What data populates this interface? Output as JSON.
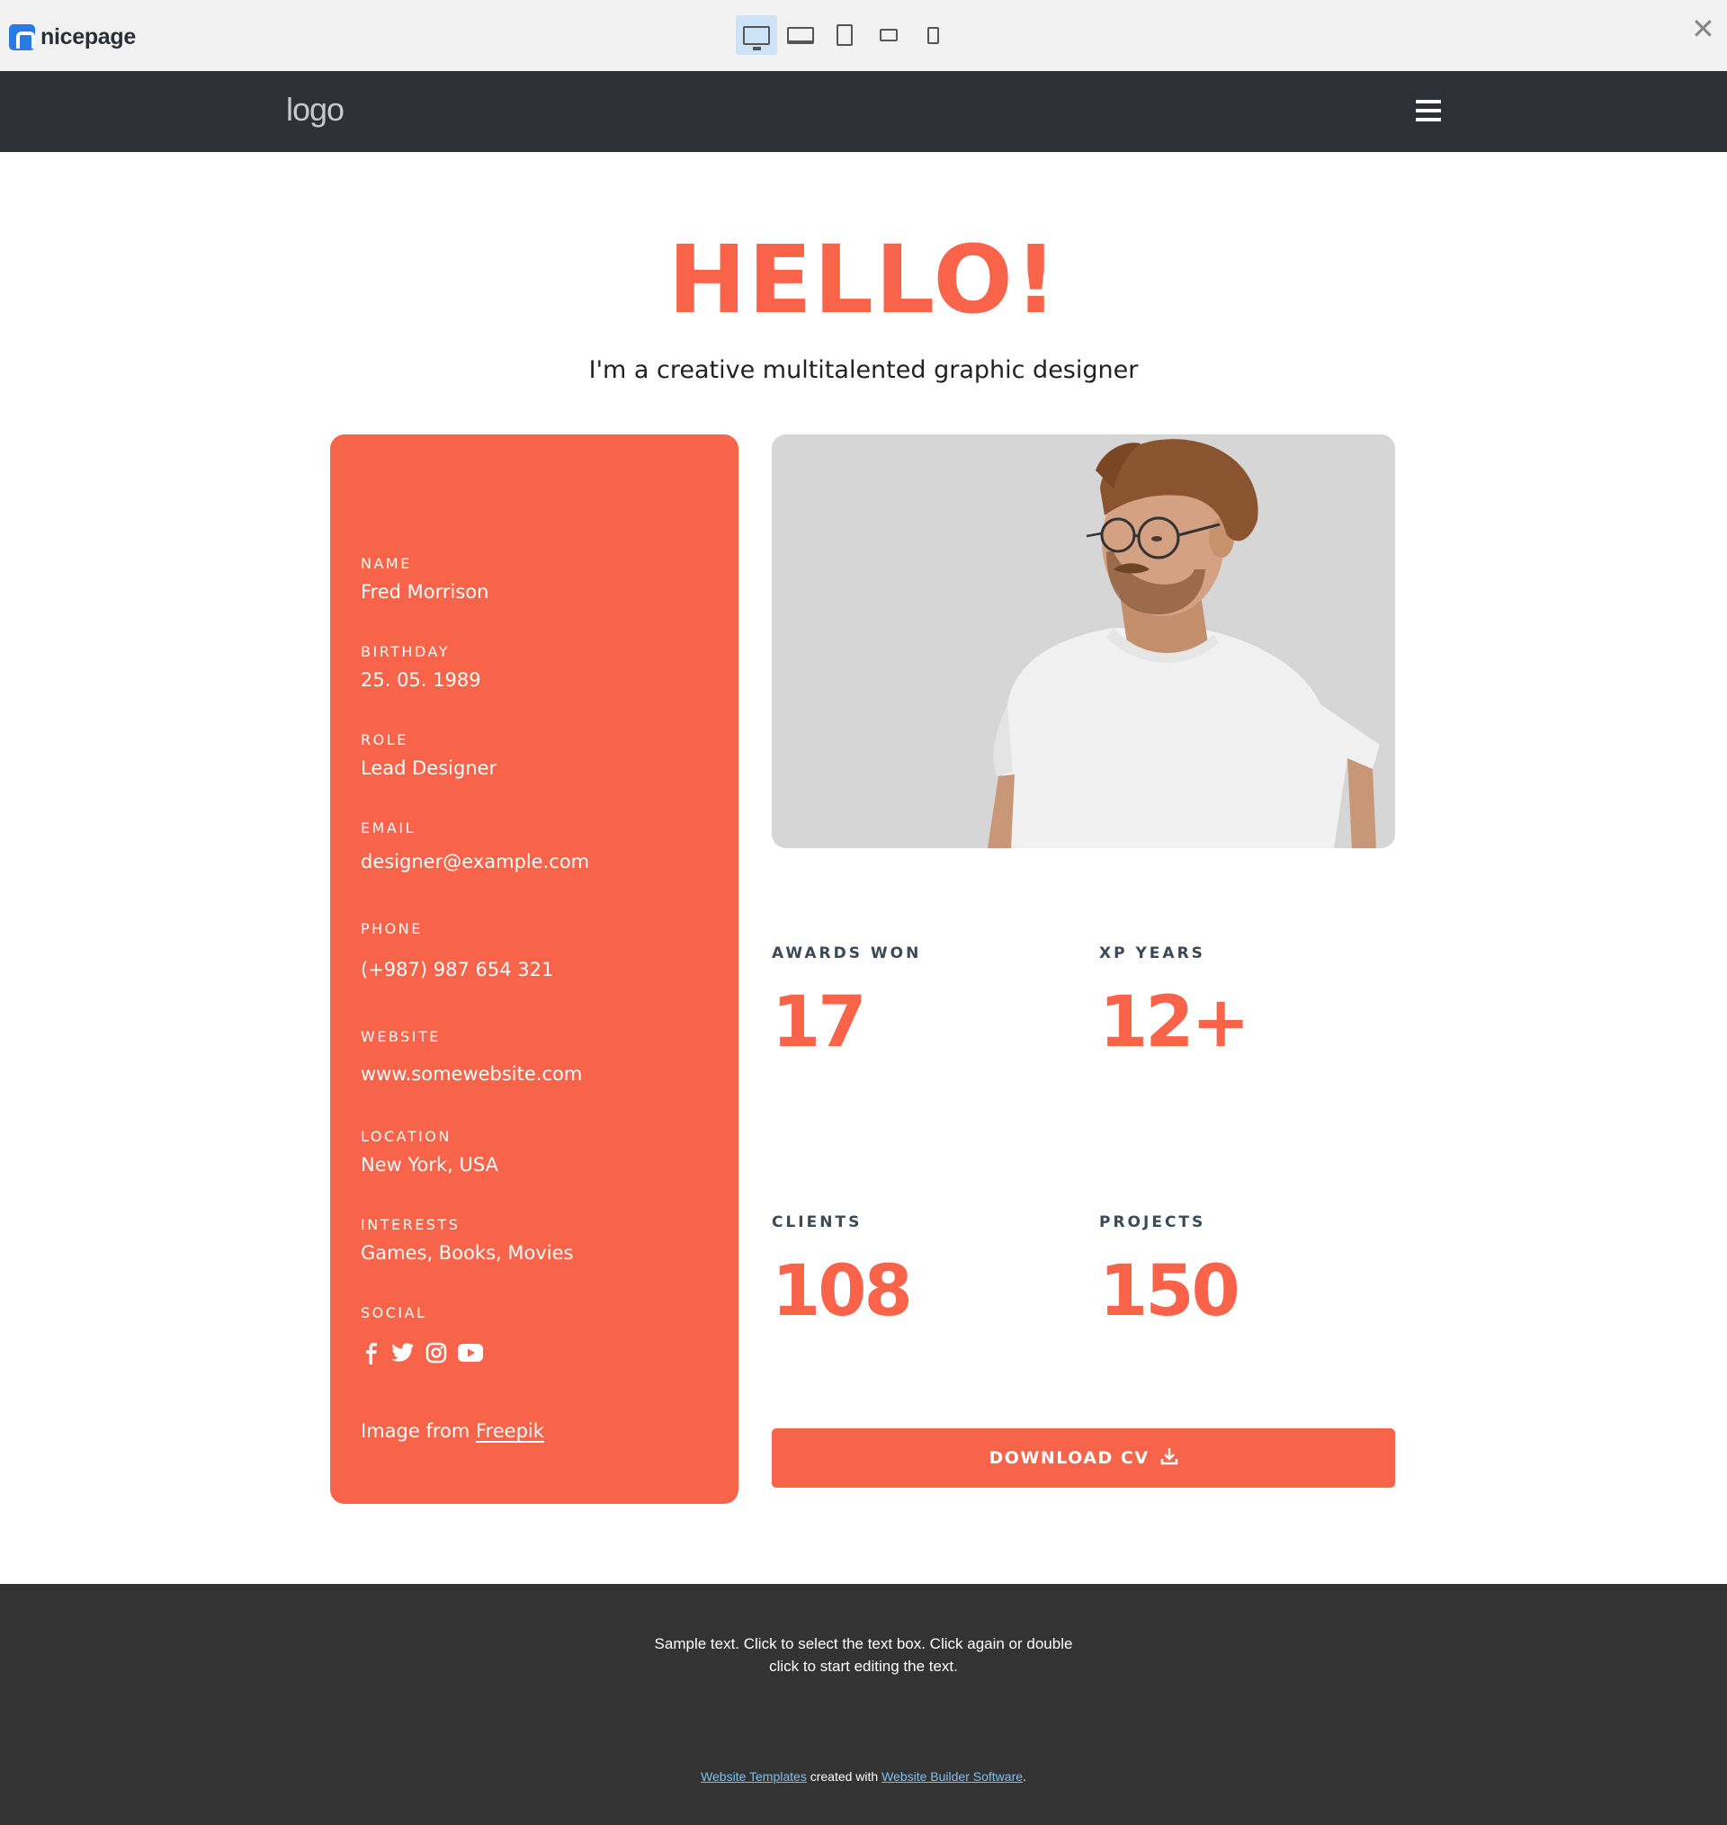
{
  "builder": {
    "brand": "nicepage",
    "devices": [
      "desktop",
      "laptop",
      "tablet",
      "tablet-landscape",
      "phone"
    ],
    "active_device": "desktop"
  },
  "header": {
    "logo": "logo"
  },
  "hero": {
    "title": "HELLO!",
    "subtitle": "I'm a creative multitalented graphic designer"
  },
  "profile": {
    "fields": [
      {
        "label": "NAME",
        "value": "Fred Morrison"
      },
      {
        "label": "BIRTHDAY",
        "value": "25. 05. 1989"
      },
      {
        "label": "ROLE",
        "value": "Lead Designer"
      },
      {
        "label": "EMAIL",
        "value": "designer@example.com"
      },
      {
        "label": "PHONE",
        "value": "(+987) 987 654 321"
      },
      {
        "label": "WEBSITE",
        "value": "www.somewebsite.com"
      },
      {
        "label": "LOCATION",
        "value": "New York, USA"
      },
      {
        "label": "INTERESTS",
        "value": "Games, Books, Movies"
      }
    ],
    "social_label": "SOCIAL",
    "social_icons": [
      "facebook-icon",
      "twitter-icon",
      "instagram-icon",
      "youtube-icon"
    ],
    "credit_prefix": "Image from ",
    "credit_link": "Freepik"
  },
  "stats": [
    {
      "label": "AWARDS WON",
      "value": "17"
    },
    {
      "label": "XP YEARS",
      "value": "12+"
    },
    {
      "label": "CLIENTS",
      "value": "108"
    },
    {
      "label": "PROJECTS",
      "value": "150"
    }
  ],
  "download": {
    "label": "DOWNLOAD CV"
  },
  "footer": {
    "line1": "Sample text. Click to select the text box. Click again or double",
    "line2": "click to start editing the text.",
    "credit_link1": "Website Templates",
    "credit_mid": " created with ",
    "credit_link2": "Website Builder Software",
    "credit_end": "."
  },
  "colors": {
    "accent": "#f8634a",
    "header_bg": "#2e3038",
    "footer_bg": "#333333"
  }
}
